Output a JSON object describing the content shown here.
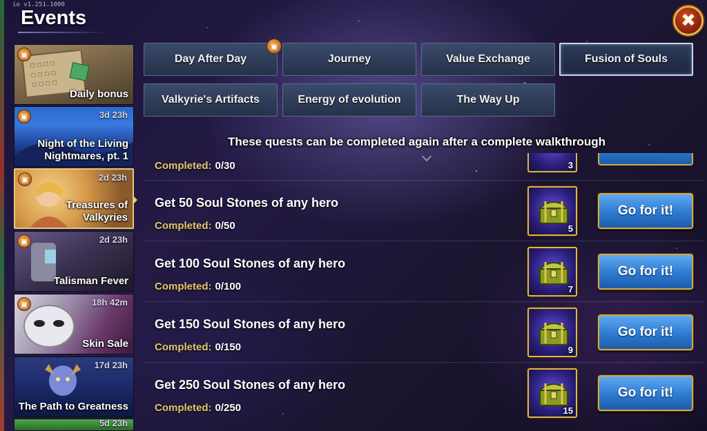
{
  "version": "io v1.251.1000",
  "title": "Events",
  "close_glyph": "✖",
  "sidebar": {
    "items": [
      {
        "label": "Daily bonus",
        "timer": "",
        "gift": true,
        "theme": "daily-bonus"
      },
      {
        "label": "Night of the Living Nightmares, pt. 1",
        "label_lines": [
          "Night of the Living",
          "Nightmares, pt. 1"
        ],
        "timer": "3d 23h",
        "gift": true
      },
      {
        "label": "Treasures of Valkyries",
        "label_lines": [
          "Treasures of",
          "Valkyries"
        ],
        "timer": "2d 23h",
        "gift": true,
        "selected": true
      },
      {
        "label": "Talisman Fever",
        "timer": "2d 23h",
        "gift": true
      },
      {
        "label": "Skin Sale",
        "timer": "18h 42m",
        "gift": true
      },
      {
        "label": "The Path to Greatness",
        "timer": "17d 23h",
        "gift": false
      },
      {
        "label": "",
        "timer": "5d 23h",
        "gift": false
      }
    ]
  },
  "tabs": [
    {
      "label": "Day After Day",
      "badge": true,
      "active": false
    },
    {
      "label": "Journey",
      "active": false
    },
    {
      "label": "Value Exchange",
      "active": false
    },
    {
      "label": "Fusion of Souls",
      "active": true
    },
    {
      "label": "Valkyrie's Artifacts",
      "active": false
    },
    {
      "label": "Energy of evolution",
      "active": false
    },
    {
      "label": "The Way Up",
      "active": false
    }
  ],
  "notice": "These quests can be completed again after a complete walkthrough",
  "completed_label": "Completed:",
  "partial_quest": {
    "progress": "0/30",
    "reward_count": "3"
  },
  "quests": [
    {
      "title": "Get 50 Soul Stones of any hero",
      "progress": "0/50",
      "reward_count": "5",
      "button": "Go for it!"
    },
    {
      "title": "Get 100 Soul Stones of any hero",
      "progress": "0/100",
      "reward_count": "7",
      "button": "Go for it!"
    },
    {
      "title": "Get 150 Soul Stones of any hero",
      "progress": "0/150",
      "reward_count": "9",
      "button": "Go for it!"
    },
    {
      "title": "Get 250 Soul Stones of any hero",
      "progress": "0/250",
      "reward_count": "15",
      "button": "Go for it!"
    }
  ],
  "icons": {
    "gift": "gift-icon",
    "close": "close-icon",
    "chest": "treasure-chest-icon"
  },
  "colors": {
    "gold": "#e0b44a",
    "button_blue": "#2d7ad0",
    "completed_gold": "#e6c86a"
  }
}
